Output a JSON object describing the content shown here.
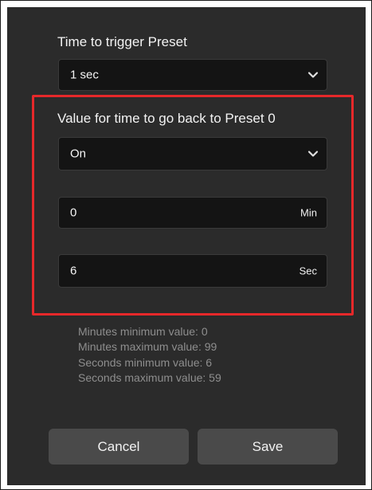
{
  "trigger": {
    "label": "Time to trigger Preset",
    "selected": "1 sec"
  },
  "go_back": {
    "label": "Value for time to go back to Preset 0",
    "selected": "On"
  },
  "minutes": {
    "value": "0",
    "unit": "Min"
  },
  "seconds": {
    "value": "6",
    "unit": "Sec"
  },
  "hints": [
    "Minutes minimum value: 0",
    "Minutes maximum value: 99",
    "Seconds minimum value: 6",
    "Seconds maximum value: 59"
  ],
  "buttons": {
    "cancel": "Cancel",
    "save": "Save"
  },
  "colors": {
    "panel": "#2b2b2b",
    "field": "#141414",
    "highlight": "#e6282a",
    "button": "#4a4a4a"
  },
  "icons": {
    "dropdown": "chevron-down-icon"
  }
}
